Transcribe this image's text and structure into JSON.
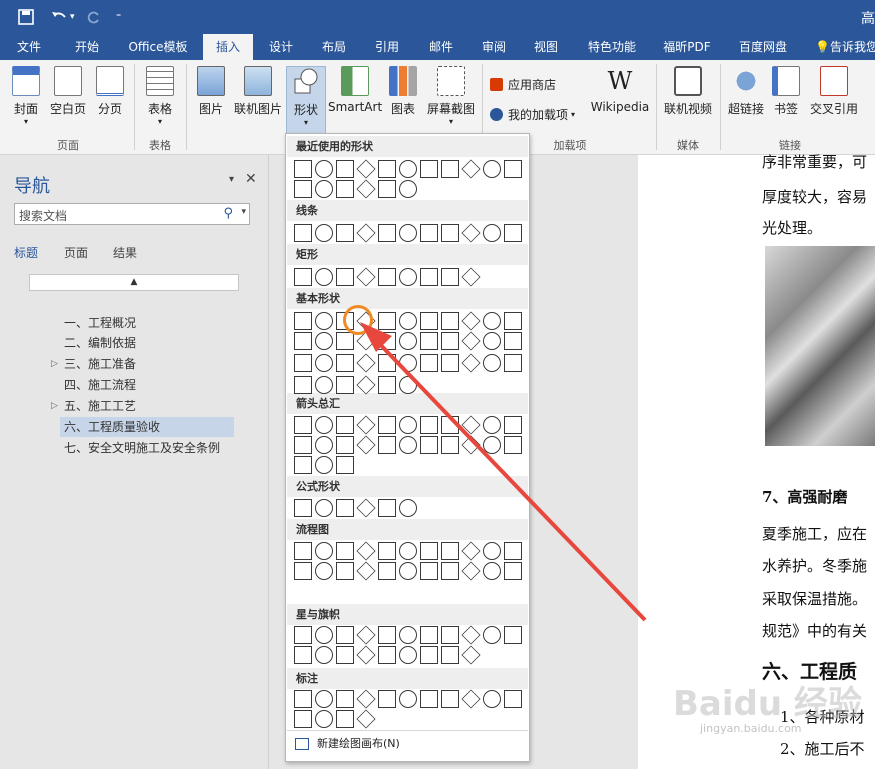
{
  "window": {
    "title_fragment": "高"
  },
  "quick_access": {
    "save_icon": "save-icon",
    "undo_icon": "undo-icon",
    "redo_icon": "redo-icon",
    "customize_icon": "customize-icon"
  },
  "tabs": [
    "文件",
    "开始",
    "Office模板",
    "插入",
    "设计",
    "布局",
    "引用",
    "邮件",
    "审阅",
    "视图",
    "特色功能",
    "福昕PDF",
    "百度网盘"
  ],
  "active_tab": "插入",
  "tell_me": "告诉我您",
  "ribbon": {
    "buttons": [
      "封面",
      "空白页",
      "分页",
      "表格",
      "图片",
      "联机图片",
      "形状",
      "SmartArt",
      "图表",
      "屏幕截图",
      "Wikipedia",
      "联机视频",
      "超链接",
      "书签",
      "交叉引用"
    ],
    "small": [
      "应用商店",
      "我的加载项"
    ],
    "groups": [
      "页面",
      "表格",
      "加载项",
      "媒体",
      "链接"
    ]
  },
  "nav": {
    "title": "导航",
    "search_placeholder": "搜索文档",
    "tabs": [
      "标题",
      "页面",
      "结果"
    ],
    "items": [
      "一、工程概况",
      "二、编制依据",
      "三、施工准备",
      "四、施工流程",
      "五、施工工艺",
      "六、工程质量验收",
      "七、安全文明施工及安全条例"
    ],
    "selected_item": "六、工程质量验收"
  },
  "document": {
    "lines": [
      "序非常重要，可",
      "厚度较大，容易",
      "光处理。",
      "7、高强耐磨",
      "夏季施工，应在",
      "水养护。冬季施",
      "采取保温措施。",
      "规范》中的有关",
      "六、工程质",
      "1、各种原材",
      "2、施工后不"
    ]
  },
  "gallery": {
    "categories": [
      "最近使用的形状",
      "线条",
      "矩形",
      "基本形状",
      "箭头总汇",
      "公式形状",
      "流程图",
      "星与旗帜",
      "标注"
    ],
    "new_canvas": "新建绘图画布(N)"
  },
  "watermark": {
    "logo": "Baidu 经验",
    "url": "jingyan.baidu.com"
  },
  "colors": {
    "brand": "#2b579a",
    "highlight": "#f08a24",
    "arrow": "#e8473d"
  }
}
